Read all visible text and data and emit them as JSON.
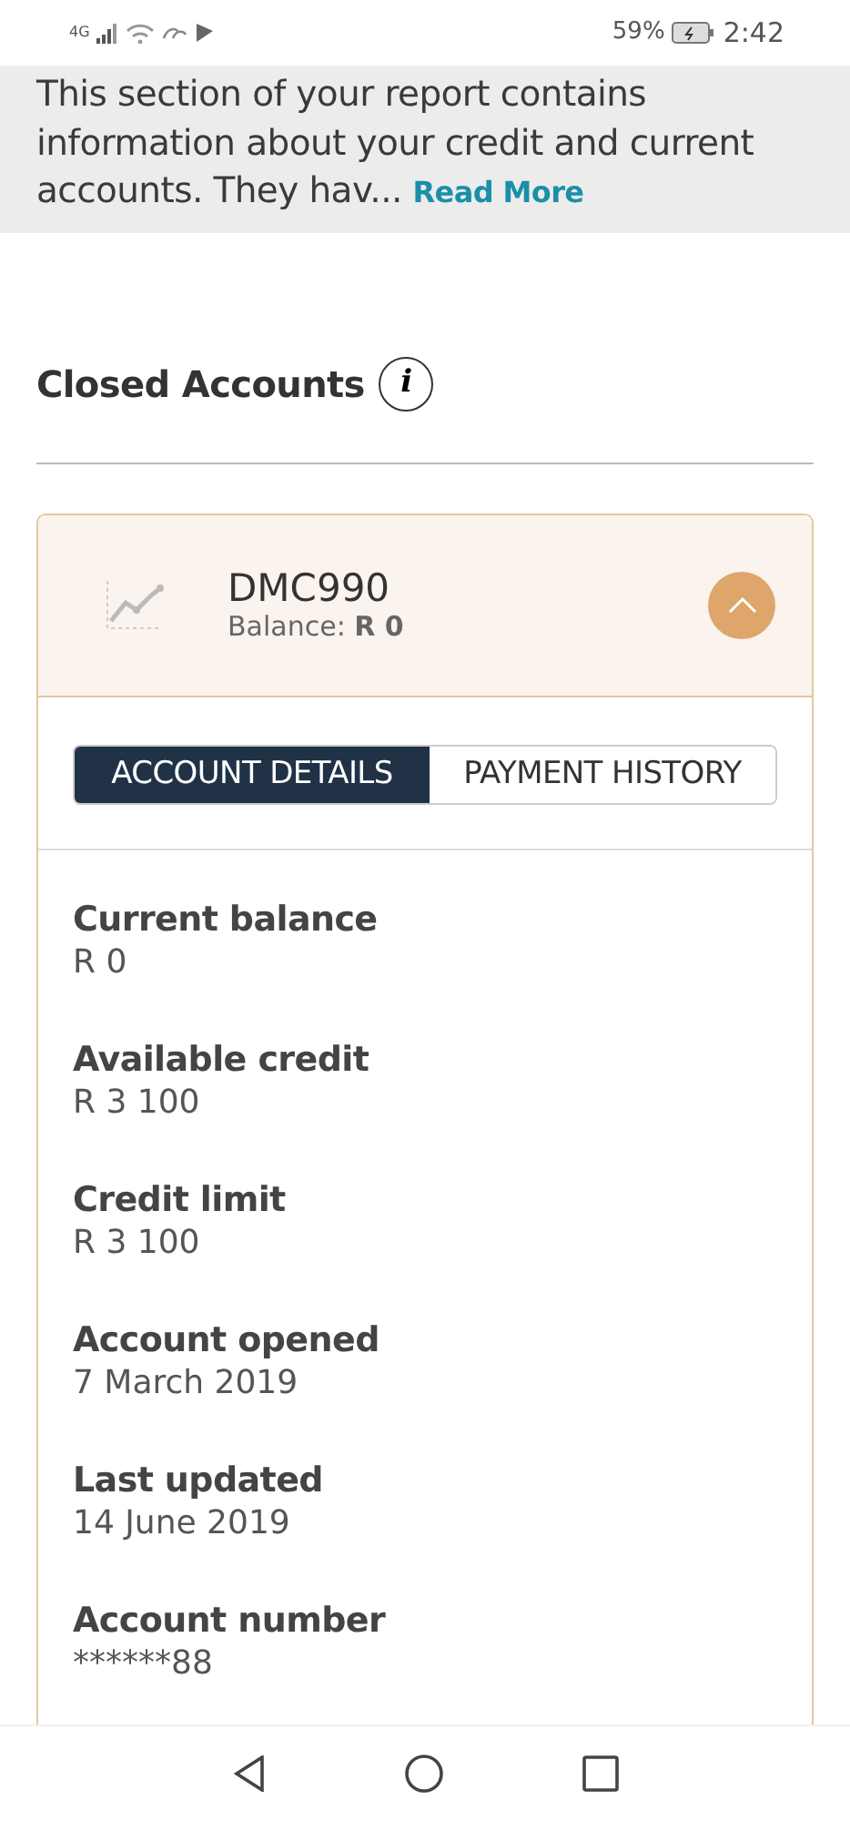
{
  "status_bar": {
    "network": "4G",
    "battery": "59%",
    "time": "2:42"
  },
  "banner": {
    "text": "This section of your report contains information about your credit and current accounts. They hav...",
    "link": "Read More"
  },
  "section": {
    "title": "Closed Accounts",
    "info_icon": "i"
  },
  "account": {
    "name": "DMC990",
    "balance": "Balance: **R 0**",
    "expanded": true,
    "tabs": [
      {
        "label": "ACCOUNT DETAILS",
        "selected": true
      },
      {
        "label": "PAYMENT HISTORY",
        "selected": false
      }
    ],
    "details": [
      {
        "label": "Current balance",
        "value": "R 0"
      },
      {
        "label": "Available credit",
        "value": "R 3 100"
      },
      {
        "label": "Credit limit",
        "value": "R 3 100"
      },
      {
        "label": "Account opened",
        "value": "7 March 2019"
      },
      {
        "label": "Last updated",
        "value": "14 June 2019"
      },
      {
        "label": "Account number",
        "value": "******88"
      }
    ]
  }
}
